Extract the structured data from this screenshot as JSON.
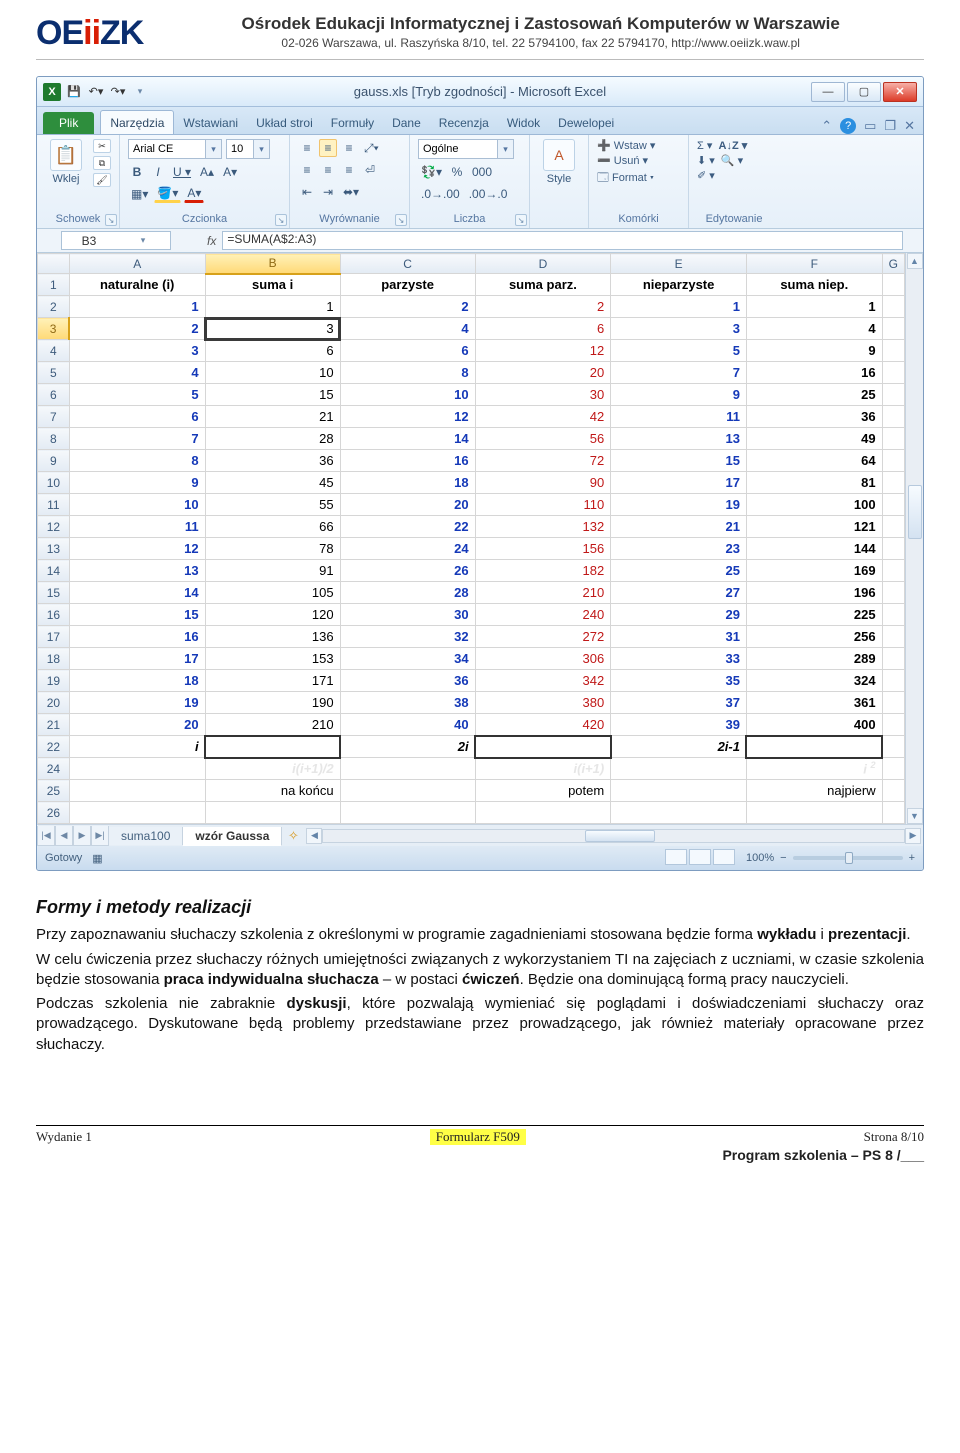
{
  "doc_header": {
    "logo_a": "OE",
    "logo_b": "ii",
    "logo_c": "ZK",
    "title": "Ośrodek Edukacji Informatycznej i Zastosowań Komputerów w Warszawie",
    "subtitle": "02-026 Warszawa, ul. Raszyńska 8/10, tel. 22 5794100, fax 22 5794170, http://www.oeiizk.waw.pl"
  },
  "excel": {
    "title": "gauss.xls  [Tryb zgodności]  -  Microsoft Excel",
    "tabs": {
      "file": "Plik",
      "list": [
        "Narzędzia",
        "Wstawiani",
        "Układ stroi",
        "Formuły",
        "Dane",
        "Recenzja",
        "Widok",
        "Dewelopei"
      ]
    },
    "groups": {
      "clipboard": {
        "label": "Schowek",
        "paste": "Wklej"
      },
      "font": {
        "label": "Czcionka",
        "fontname": "Arial CE",
        "size": "10"
      },
      "alignment": {
        "label": "Wyrównanie"
      },
      "number": {
        "label": "Liczba",
        "format": "Ogólne"
      },
      "styles": {
        "label": "Style",
        "btn": "Style"
      },
      "cells": {
        "label": "Komórki",
        "insert": "Wstaw",
        "delete": "Usuń",
        "format": "Format"
      },
      "editing": {
        "label": "Edytowanie"
      }
    },
    "fx": {
      "name": "B3",
      "formula": "=SUMA(A$2:A3)"
    },
    "cols": [
      "A",
      "B",
      "C",
      "D",
      "E",
      "F",
      "G"
    ],
    "hdr": [
      "naturalne (i)",
      "suma i",
      "parzyste",
      "suma parz.",
      "nieparzyste",
      "suma niep."
    ],
    "rows": [
      {
        "n": "2",
        "a": "1",
        "b": "1",
        "c": "2",
        "d": "2",
        "e": "1",
        "f": "1"
      },
      {
        "n": "3",
        "a": "2",
        "b": "3",
        "c": "4",
        "d": "6",
        "e": "3",
        "f": "4"
      },
      {
        "n": "4",
        "a": "3",
        "b": "6",
        "c": "6",
        "d": "12",
        "e": "5",
        "f": "9"
      },
      {
        "n": "5",
        "a": "4",
        "b": "10",
        "c": "8",
        "d": "20",
        "e": "7",
        "f": "16"
      },
      {
        "n": "6",
        "a": "5",
        "b": "15",
        "c": "10",
        "d": "30",
        "e": "9",
        "f": "25"
      },
      {
        "n": "7",
        "a": "6",
        "b": "21",
        "c": "12",
        "d": "42",
        "e": "11",
        "f": "36"
      },
      {
        "n": "8",
        "a": "7",
        "b": "28",
        "c": "14",
        "d": "56",
        "e": "13",
        "f": "49"
      },
      {
        "n": "9",
        "a": "8",
        "b": "36",
        "c": "16",
        "d": "72",
        "e": "15",
        "f": "64"
      },
      {
        "n": "10",
        "a": "9",
        "b": "45",
        "c": "18",
        "d": "90",
        "e": "17",
        "f": "81"
      },
      {
        "n": "11",
        "a": "10",
        "b": "55",
        "c": "20",
        "d": "110",
        "e": "19",
        "f": "100"
      },
      {
        "n": "12",
        "a": "11",
        "b": "66",
        "c": "22",
        "d": "132",
        "e": "21",
        "f": "121"
      },
      {
        "n": "13",
        "a": "12",
        "b": "78",
        "c": "24",
        "d": "156",
        "e": "23",
        "f": "144"
      },
      {
        "n": "14",
        "a": "13",
        "b": "91",
        "c": "26",
        "d": "182",
        "e": "25",
        "f": "169"
      },
      {
        "n": "15",
        "a": "14",
        "b": "105",
        "c": "28",
        "d": "210",
        "e": "27",
        "f": "196"
      },
      {
        "n": "16",
        "a": "15",
        "b": "120",
        "c": "30",
        "d": "240",
        "e": "29",
        "f": "225"
      },
      {
        "n": "17",
        "a": "16",
        "b": "136",
        "c": "32",
        "d": "272",
        "e": "31",
        "f": "256"
      },
      {
        "n": "18",
        "a": "17",
        "b": "153",
        "c": "34",
        "d": "306",
        "e": "33",
        "f": "289"
      },
      {
        "n": "19",
        "a": "18",
        "b": "171",
        "c": "36",
        "d": "342",
        "e": "35",
        "f": "324"
      },
      {
        "n": "20",
        "a": "19",
        "b": "190",
        "c": "38",
        "d": "380",
        "e": "37",
        "f": "361"
      },
      {
        "n": "21",
        "a": "20",
        "b": "210",
        "c": "40",
        "d": "420",
        "e": "39",
        "f": "400"
      }
    ],
    "row22": {
      "n": "22",
      "a": "i",
      "c": "2i",
      "e": "2i-1"
    },
    "row24": {
      "n": "24",
      "b": "i(i+1)/2",
      "d": "i(i+1)",
      "f": "i"
    },
    "row24_sup": "2",
    "row25": {
      "n": "25",
      "b": "na końcu",
      "d": "potem",
      "f": "najpierw"
    },
    "row26": "26",
    "sheets": {
      "s1": "suma100",
      "s2": "wzór Gaussa"
    },
    "status": {
      "ready": "Gotowy",
      "zoom": "100%"
    }
  },
  "body": {
    "title": "Formy i metody realizacji",
    "p1a": "Przy zapoznawaniu słuchaczy szkolenia z określonymi w programie zagadnieniami stosowana będzie forma ",
    "p1b": "wykładu",
    "p1c": " i ",
    "p1d": "prezentacji",
    "p1e": ".",
    "p2a": "W celu ćwiczenia przez słuchaczy różnych umiejętności związanych z wykorzystaniem TI na zajęciach z uczniami, w czasie szkolenia będzie stosowania ",
    "p2b": "praca indywidualna słuchacza",
    "p2c": " – w postaci ",
    "p2d": "ćwiczeń",
    "p2e": ". Będzie ona dominującą formą pracy nauczycieli.",
    "p3a": "Podczas szkolenia nie zabraknie ",
    "p3b": "dyskusji",
    "p3c": ", które pozwalają wymieniać się poglądami i doświadczeniami słuchaczy oraz prowadzącego. Dyskutowane będą problemy przedstawiane przez prowadzącego, jak również materiały opracowane przez słuchaczy."
  },
  "footer": {
    "left": "Wydanie 1",
    "mid": "Formularz  F509",
    "right": "Strona 8/10",
    "line2": "Program szkolenia – PS 8 /___"
  }
}
